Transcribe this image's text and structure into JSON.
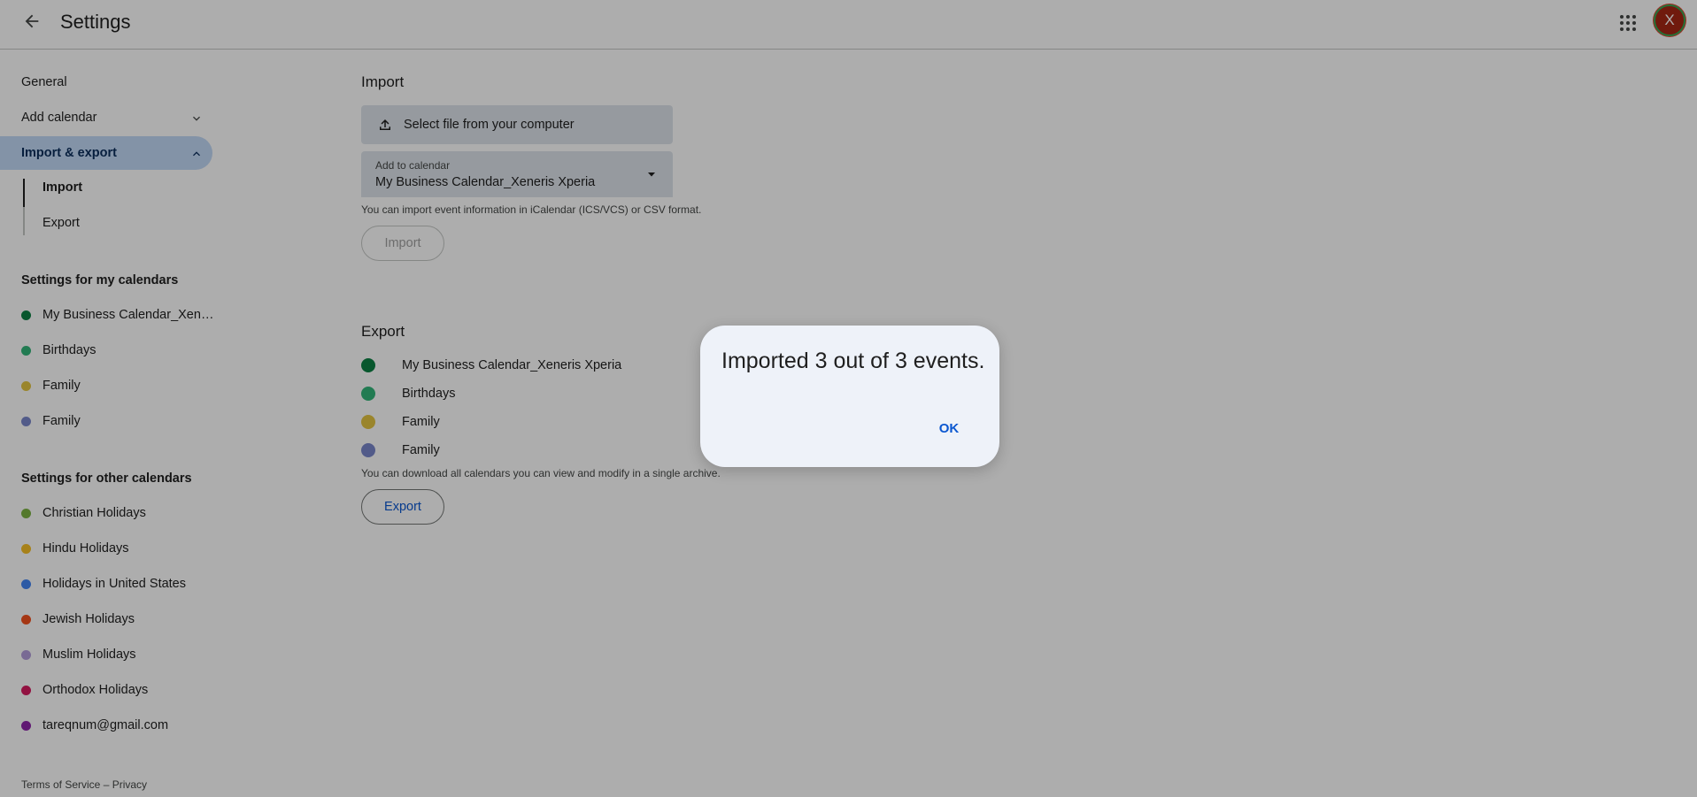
{
  "header": {
    "title": "Settings",
    "avatar_letter": "X"
  },
  "sidebar": {
    "general": "General",
    "add_calendar": "Add calendar",
    "import_export": "Import & export",
    "import": "Import",
    "export": "Export",
    "my_calendars_heading": "Settings for my calendars",
    "my_calendars": [
      {
        "label": "My Business Calendar_Xene...",
        "color": "#0b8043"
      },
      {
        "label": "Birthdays",
        "color": "#33b679"
      },
      {
        "label": "Family",
        "color": "#e4c441"
      },
      {
        "label": "Family",
        "color": "#7986cb"
      }
    ],
    "other_calendars_heading": "Settings for other calendars",
    "other_calendars": [
      {
        "label": "Christian Holidays",
        "color": "#7cb342"
      },
      {
        "label": "Hindu Holidays",
        "color": "#f6bf26"
      },
      {
        "label": "Holidays in United States",
        "color": "#4285f4"
      },
      {
        "label": "Jewish Holidays",
        "color": "#f4511e"
      },
      {
        "label": "Muslim Holidays",
        "color": "#b39ddb"
      },
      {
        "label": "Orthodox Holidays",
        "color": "#d81b60"
      },
      {
        "label": "tareqnum@gmail.com",
        "color": "#8e24aa"
      }
    ],
    "footer": {
      "terms": "Terms of Service",
      "separator": " – ",
      "privacy": "Privacy"
    }
  },
  "import_section": {
    "heading": "Import",
    "select_file": "Select file from your computer",
    "add_to_calendar_label": "Add to calendar",
    "add_to_calendar_value": "My Business Calendar_Xeneris Xperia",
    "hint": "You can import event information in iCalendar (ICS/VCS) or CSV format.",
    "import_button": "Import"
  },
  "export_section": {
    "heading": "Export",
    "calendars": [
      {
        "label": "My Business Calendar_Xeneris Xperia",
        "color": "#0b8043"
      },
      {
        "label": "Birthdays",
        "color": "#33b679"
      },
      {
        "label": "Family",
        "color": "#e4c441"
      },
      {
        "label": "Family",
        "color": "#7986cb"
      }
    ],
    "hint": "You can download all calendars you can view and modify in a single archive.",
    "export_button": "Export"
  },
  "dialog": {
    "message": "Imported 3 out of 3 events.",
    "ok_label": "OK"
  }
}
